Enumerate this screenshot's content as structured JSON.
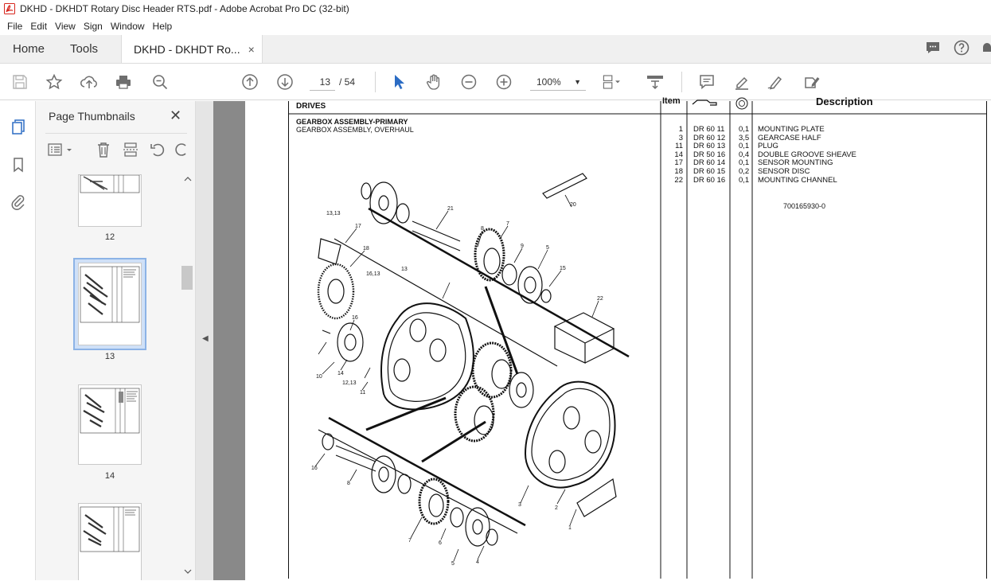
{
  "window": {
    "title": "DKHD - DKHDT Rotary Disc Header RTS.pdf - Adobe Acrobat Pro DC (32-bit)"
  },
  "menu": {
    "items": [
      "File",
      "Edit",
      "View",
      "Sign",
      "Window",
      "Help"
    ]
  },
  "tabs": {
    "home": "Home",
    "tools": "Tools",
    "document": "DKHD - DKHDT Ro...",
    "close": "×"
  },
  "toolbar": {
    "current_page": "13",
    "page_total": "/ 54",
    "zoom": "100%",
    "zoom_caret": "▼"
  },
  "thumbnails": {
    "title": "Page Thumbnails",
    "close": "✕",
    "pages": [
      {
        "label": "12"
      },
      {
        "label": "13"
      },
      {
        "label": "14"
      },
      {
        "label": ""
      }
    ],
    "selected_index": 1
  },
  "document": {
    "section": "DRIVES",
    "assembly_title": "GEARBOX ASSEMBLY-PRIMARY",
    "assembly_subtitle": "GEARBOX ASSEMBLY, OVERHAUL",
    "header_item": "Item",
    "header_description": "Description",
    "reference_number": "700165930-0",
    "parts": [
      {
        "item": "1",
        "part": "DR 60 11",
        "wt": "0,1",
        "desc": "MOUNTING PLATE"
      },
      {
        "item": "3",
        "part": "DR 60 12",
        "wt": "3,5",
        "desc": "GEARCASE HALF"
      },
      {
        "item": "11",
        "part": "DR 60 13",
        "wt": "0,1",
        "desc": "PLUG"
      },
      {
        "item": "14",
        "part": "DR 50 16",
        "wt": "0,4",
        "desc": "DOUBLE GROOVE SHEAVE"
      },
      {
        "item": "17",
        "part": "DR 60 14",
        "wt": "0,1",
        "desc": "SENSOR MOUNTING"
      },
      {
        "item": "18",
        "part": "DR 60 15",
        "wt": "0,2",
        "desc": "SENSOR DISC"
      },
      {
        "item": "22",
        "part": "DR 60 16",
        "wt": "0,1",
        "desc": "MOUNTING CHANNEL"
      }
    ],
    "callouts": [
      "21",
      "7",
      "8",
      "9",
      "5",
      "15",
      "20",
      "17",
      "13,13",
      "18",
      "16,13",
      "22",
      "13",
      "16",
      "14",
      "10",
      "12,13",
      "11",
      "1",
      "2",
      "3",
      "4",
      "5",
      "6",
      "7",
      "8",
      "16"
    ]
  },
  "colors": {
    "accent_blue": "#2b6cc4",
    "selected_thumb_bg": "#cfe0f7",
    "gutter": "#898989",
    "icon_gray": "#6e6e6e",
    "adobe_red": "#d7261e"
  }
}
